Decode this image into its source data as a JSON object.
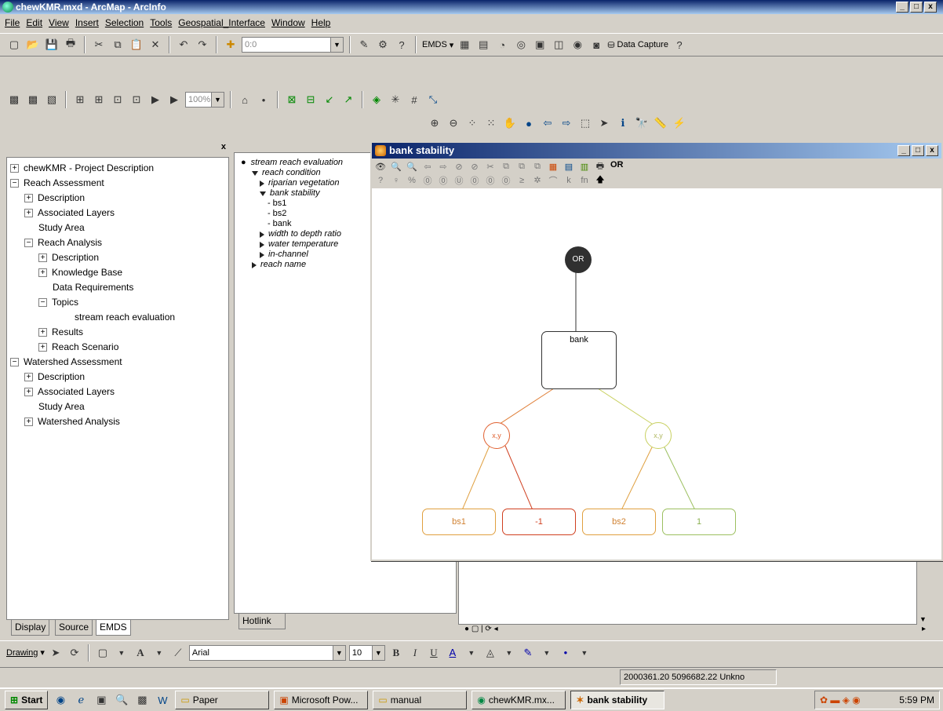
{
  "app": {
    "title": "chewKMR.mxd - ArcMap - ArcInfo",
    "window_buttons": [
      "_",
      "□",
      "x"
    ]
  },
  "menu": [
    "File",
    "Edit",
    "View",
    "Insert",
    "Selection",
    "Tools",
    "Geospatial_Interface",
    "Window",
    "Help"
  ],
  "toolbar1": {
    "scale_value": "0:0",
    "emds_label": "EMDS",
    "data_capture_label": "Data Capture"
  },
  "toolbar2": {
    "zoom_value": "100%"
  },
  "toc": {
    "items": [
      {
        "label": "chewKMR - Project Description",
        "sign": "+"
      },
      {
        "label": "Reach Assessment",
        "sign": "−"
      },
      {
        "label": "Description",
        "sign": "+"
      },
      {
        "label": "Associated Layers",
        "sign": "+"
      },
      {
        "label": "Study Area",
        "sign": ""
      },
      {
        "label": "Reach Analysis",
        "sign": "−"
      },
      {
        "label": "Description",
        "sign": "+"
      },
      {
        "label": "Knowledge Base",
        "sign": "+"
      },
      {
        "label": "Data Requirements",
        "sign": ""
      },
      {
        "label": "Topics",
        "sign": "−"
      },
      {
        "label": "stream reach evaluation",
        "sign": ""
      },
      {
        "label": "Results",
        "sign": "+"
      },
      {
        "label": "Reach Scenario",
        "sign": "+"
      },
      {
        "label": "Watershed Assessment",
        "sign": "−"
      },
      {
        "label": "Description",
        "sign": "+"
      },
      {
        "label": "Associated Layers",
        "sign": "+"
      },
      {
        "label": "Study Area",
        "sign": ""
      },
      {
        "label": "Watershed Analysis",
        "sign": "+"
      }
    ],
    "tabs": [
      "Display",
      "Source",
      "EMDS"
    ]
  },
  "topics": {
    "items": [
      "stream reach evaluation",
      "reach condition",
      "riparian vegetation",
      "bank stability",
      "bs1",
      "bs2",
      "bank",
      "width to depth ratio",
      "water temperature",
      "in-channel",
      "reach name"
    ],
    "hotlink_tab": "Hotlink"
  },
  "bank_window": {
    "title": "bank stability",
    "operator_label": "OR",
    "buttons": [
      "_",
      "□",
      "x"
    ],
    "nodes": {
      "root": "OR",
      "bank": "bank",
      "op_left": "x,y",
      "op_right": "x,y",
      "leaf1": "bs1",
      "leaf2": "-1",
      "leaf3": "bs2",
      "leaf4": "1"
    },
    "colors": {
      "root": "#303030",
      "left_branch": "#e0803a",
      "right_branch": "#c8d060",
      "neg": "#d04020",
      "pos": "#7cc060"
    }
  },
  "drawing": {
    "label": "Drawing",
    "font": "Arial",
    "size": "10",
    "bold": "B",
    "italic": "I",
    "underline": "U"
  },
  "status": {
    "coords": "2000361.20  5096682.22 Unkno"
  },
  "taskbar": {
    "start": "Start",
    "items": [
      "Paper",
      "Microsoft Pow...",
      "manual",
      "chewKMR.mx...",
      "bank stability"
    ],
    "clock": "5:59 PM"
  }
}
